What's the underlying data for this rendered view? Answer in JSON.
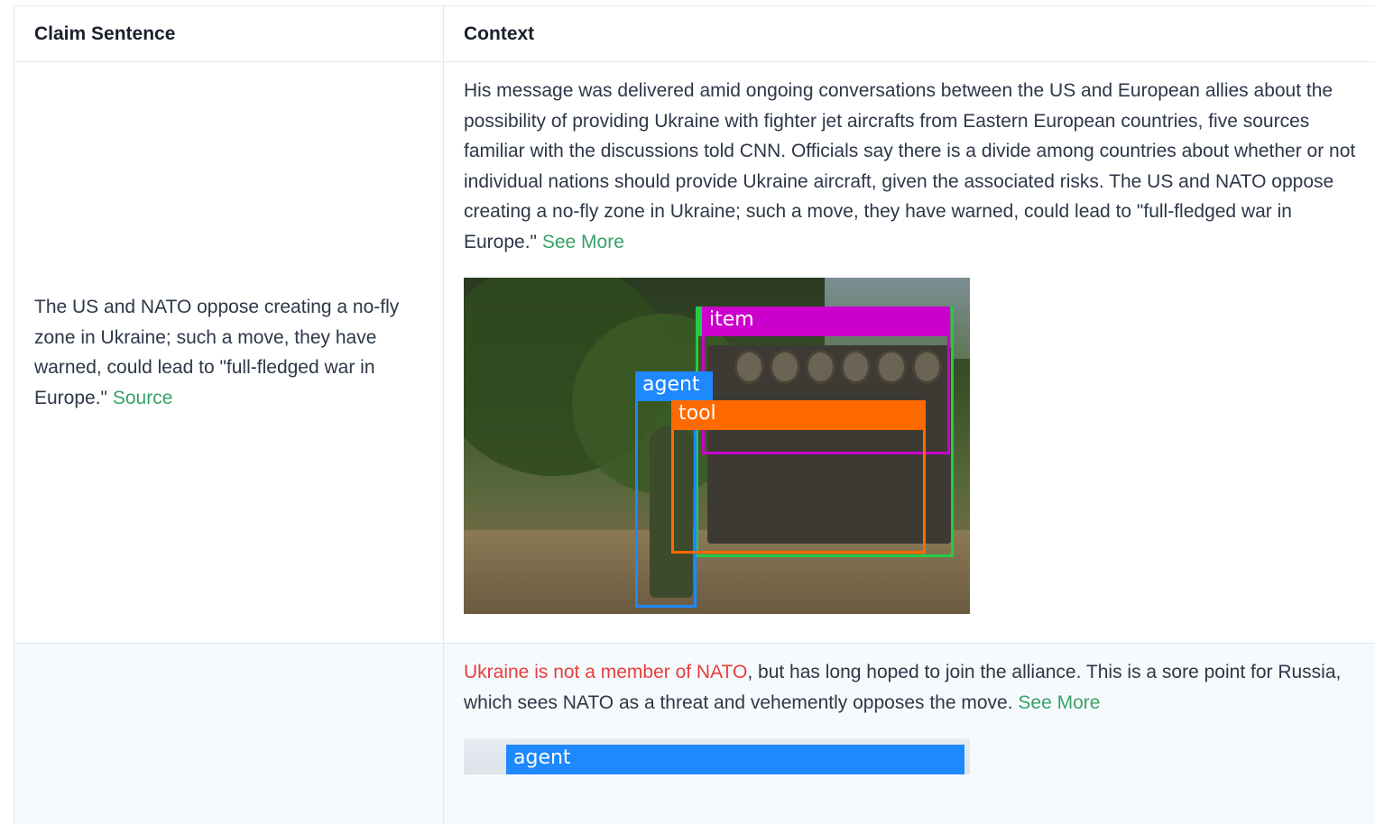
{
  "table": {
    "headers": {
      "claim": "Claim Sentence",
      "context": "Context"
    },
    "rows": [
      {
        "claim": "The US and NATO oppose creating a no-fly zone in Ukraine; such a move, they have warned, could lead to \"full-fledged war in Europe.\"",
        "claim_link": "Source",
        "context": "His message was delivered amid ongoing conversations between the US and European allies about the possibility of providing Ukraine with fighter jet aircrafts from Eastern European countries, five sources familiar with the discussions told CNN. Officials say there is a divide among countries about whether or not individual nations should provide Ukraine aircraft, given the associated risks. The US and NATO oppose creating a no-fly zone in Ukraine; such a move, they have warned, could lead to \"full-fledged war in Europe.\"",
        "context_link": "See More",
        "labels": [
          {
            "text": "item",
            "color": "#cc00cc"
          },
          {
            "text": "agent",
            "color": "#1e88ff"
          },
          {
            "text": "tool",
            "color": "#ff6a00"
          },
          {
            "text": "",
            "color": "#22cc44"
          }
        ]
      },
      {
        "claim": "",
        "context_highlight": "Ukraine is not a member of NATO",
        "context": ", but has long hoped to join the alliance. This is a sore point for Russia, which sees NATO as a threat and vehemently opposes the move.",
        "context_link": "See More",
        "labels": [
          {
            "text": "agent",
            "color": "#1e88ff"
          }
        ]
      }
    ]
  }
}
